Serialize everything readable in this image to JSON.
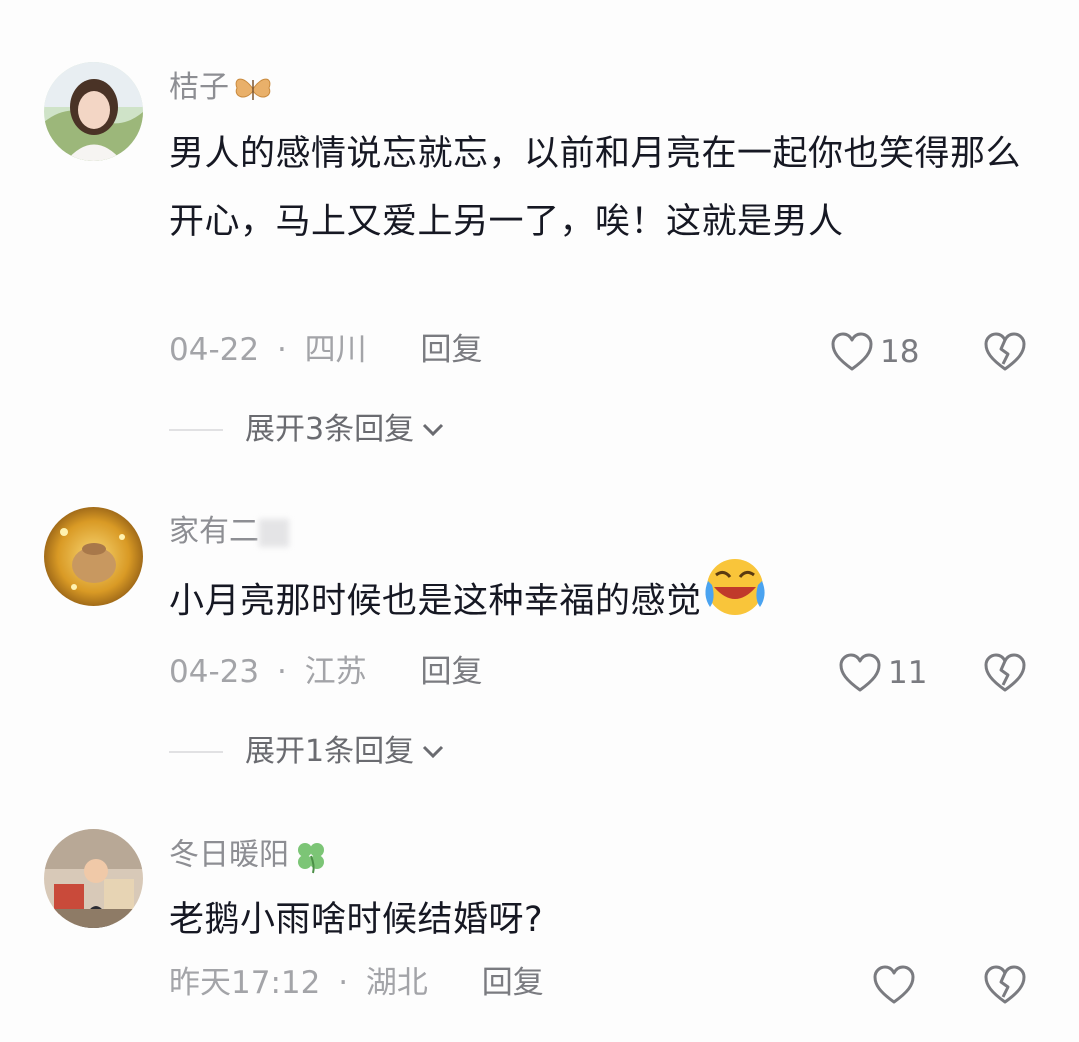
{
  "comments": [
    {
      "username": "桔子",
      "username_decoration": "butterfly-icon",
      "text": "男人的感情说忘就忘，以前和月亮在一起你也笑得那么开心，马上又爱上另一了，唉！这就是男人",
      "date": "04-22",
      "separator": "·",
      "location": "四川",
      "reply_label": "回复",
      "likes": "18",
      "expand_label": "展开3条回复"
    },
    {
      "username": "家有二",
      "username_decoration": "blurred-character",
      "text": "小月亮那时候也是这种幸福的感觉",
      "text_emoji": "laughing-crying-emoji",
      "date": "04-23",
      "separator": "·",
      "location": "江苏",
      "reply_label": "回复",
      "likes": "11",
      "expand_label": "展开1条回复"
    },
    {
      "username": "冬日暖阳",
      "username_decoration": "four-leaf-clover-icon",
      "text": "老鹅小雨啥时候结婚呀?",
      "date": "昨天17:12",
      "separator": "·",
      "location": "湖北",
      "reply_label": "回复",
      "likes": ""
    }
  ],
  "colors": {
    "username": "#8d8e93",
    "text": "#161823",
    "meta": "#a3a4a8",
    "icon": "#7a7b80"
  }
}
